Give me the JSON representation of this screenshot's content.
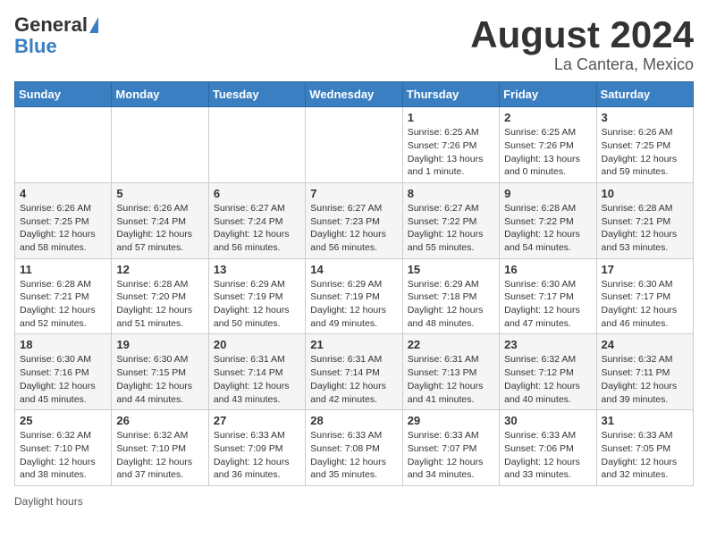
{
  "header": {
    "logo_general": "General",
    "logo_blue": "Blue",
    "title": "August 2024",
    "location": "La Cantera, Mexico"
  },
  "days_of_week": [
    "Sunday",
    "Monday",
    "Tuesday",
    "Wednesday",
    "Thursday",
    "Friday",
    "Saturday"
  ],
  "weeks": [
    [
      {
        "day": "",
        "sunrise": "",
        "sunset": "",
        "daylight": ""
      },
      {
        "day": "",
        "sunrise": "",
        "sunset": "",
        "daylight": ""
      },
      {
        "day": "",
        "sunrise": "",
        "sunset": "",
        "daylight": ""
      },
      {
        "day": "",
        "sunrise": "",
        "sunset": "",
        "daylight": ""
      },
      {
        "day": "1",
        "sunrise": "Sunrise: 6:25 AM",
        "sunset": "Sunset: 7:26 PM",
        "daylight": "Daylight: 13 hours and 1 minute."
      },
      {
        "day": "2",
        "sunrise": "Sunrise: 6:25 AM",
        "sunset": "Sunset: 7:26 PM",
        "daylight": "Daylight: 13 hours and 0 minutes."
      },
      {
        "day": "3",
        "sunrise": "Sunrise: 6:26 AM",
        "sunset": "Sunset: 7:25 PM",
        "daylight": "Daylight: 12 hours and 59 minutes."
      }
    ],
    [
      {
        "day": "4",
        "sunrise": "Sunrise: 6:26 AM",
        "sunset": "Sunset: 7:25 PM",
        "daylight": "Daylight: 12 hours and 58 minutes."
      },
      {
        "day": "5",
        "sunrise": "Sunrise: 6:26 AM",
        "sunset": "Sunset: 7:24 PM",
        "daylight": "Daylight: 12 hours and 57 minutes."
      },
      {
        "day": "6",
        "sunrise": "Sunrise: 6:27 AM",
        "sunset": "Sunset: 7:24 PM",
        "daylight": "Daylight: 12 hours and 56 minutes."
      },
      {
        "day": "7",
        "sunrise": "Sunrise: 6:27 AM",
        "sunset": "Sunset: 7:23 PM",
        "daylight": "Daylight: 12 hours and 56 minutes."
      },
      {
        "day": "8",
        "sunrise": "Sunrise: 6:27 AM",
        "sunset": "Sunset: 7:22 PM",
        "daylight": "Daylight: 12 hours and 55 minutes."
      },
      {
        "day": "9",
        "sunrise": "Sunrise: 6:28 AM",
        "sunset": "Sunset: 7:22 PM",
        "daylight": "Daylight: 12 hours and 54 minutes."
      },
      {
        "day": "10",
        "sunrise": "Sunrise: 6:28 AM",
        "sunset": "Sunset: 7:21 PM",
        "daylight": "Daylight: 12 hours and 53 minutes."
      }
    ],
    [
      {
        "day": "11",
        "sunrise": "Sunrise: 6:28 AM",
        "sunset": "Sunset: 7:21 PM",
        "daylight": "Daylight: 12 hours and 52 minutes."
      },
      {
        "day": "12",
        "sunrise": "Sunrise: 6:28 AM",
        "sunset": "Sunset: 7:20 PM",
        "daylight": "Daylight: 12 hours and 51 minutes."
      },
      {
        "day": "13",
        "sunrise": "Sunrise: 6:29 AM",
        "sunset": "Sunset: 7:19 PM",
        "daylight": "Daylight: 12 hours and 50 minutes."
      },
      {
        "day": "14",
        "sunrise": "Sunrise: 6:29 AM",
        "sunset": "Sunset: 7:19 PM",
        "daylight": "Daylight: 12 hours and 49 minutes."
      },
      {
        "day": "15",
        "sunrise": "Sunrise: 6:29 AM",
        "sunset": "Sunset: 7:18 PM",
        "daylight": "Daylight: 12 hours and 48 minutes."
      },
      {
        "day": "16",
        "sunrise": "Sunrise: 6:30 AM",
        "sunset": "Sunset: 7:17 PM",
        "daylight": "Daylight: 12 hours and 47 minutes."
      },
      {
        "day": "17",
        "sunrise": "Sunrise: 6:30 AM",
        "sunset": "Sunset: 7:17 PM",
        "daylight": "Daylight: 12 hours and 46 minutes."
      }
    ],
    [
      {
        "day": "18",
        "sunrise": "Sunrise: 6:30 AM",
        "sunset": "Sunset: 7:16 PM",
        "daylight": "Daylight: 12 hours and 45 minutes."
      },
      {
        "day": "19",
        "sunrise": "Sunrise: 6:30 AM",
        "sunset": "Sunset: 7:15 PM",
        "daylight": "Daylight: 12 hours and 44 minutes."
      },
      {
        "day": "20",
        "sunrise": "Sunrise: 6:31 AM",
        "sunset": "Sunset: 7:14 PM",
        "daylight": "Daylight: 12 hours and 43 minutes."
      },
      {
        "day": "21",
        "sunrise": "Sunrise: 6:31 AM",
        "sunset": "Sunset: 7:14 PM",
        "daylight": "Daylight: 12 hours and 42 minutes."
      },
      {
        "day": "22",
        "sunrise": "Sunrise: 6:31 AM",
        "sunset": "Sunset: 7:13 PM",
        "daylight": "Daylight: 12 hours and 41 minutes."
      },
      {
        "day": "23",
        "sunrise": "Sunrise: 6:32 AM",
        "sunset": "Sunset: 7:12 PM",
        "daylight": "Daylight: 12 hours and 40 minutes."
      },
      {
        "day": "24",
        "sunrise": "Sunrise: 6:32 AM",
        "sunset": "Sunset: 7:11 PM",
        "daylight": "Daylight: 12 hours and 39 minutes."
      }
    ],
    [
      {
        "day": "25",
        "sunrise": "Sunrise: 6:32 AM",
        "sunset": "Sunset: 7:10 PM",
        "daylight": "Daylight: 12 hours and 38 minutes."
      },
      {
        "day": "26",
        "sunrise": "Sunrise: 6:32 AM",
        "sunset": "Sunset: 7:10 PM",
        "daylight": "Daylight: 12 hours and 37 minutes."
      },
      {
        "day": "27",
        "sunrise": "Sunrise: 6:33 AM",
        "sunset": "Sunset: 7:09 PM",
        "daylight": "Daylight: 12 hours and 36 minutes."
      },
      {
        "day": "28",
        "sunrise": "Sunrise: 6:33 AM",
        "sunset": "Sunset: 7:08 PM",
        "daylight": "Daylight: 12 hours and 35 minutes."
      },
      {
        "day": "29",
        "sunrise": "Sunrise: 6:33 AM",
        "sunset": "Sunset: 7:07 PM",
        "daylight": "Daylight: 12 hours and 34 minutes."
      },
      {
        "day": "30",
        "sunrise": "Sunrise: 6:33 AM",
        "sunset": "Sunset: 7:06 PM",
        "daylight": "Daylight: 12 hours and 33 minutes."
      },
      {
        "day": "31",
        "sunrise": "Sunrise: 6:33 AM",
        "sunset": "Sunset: 7:05 PM",
        "daylight": "Daylight: 12 hours and 32 minutes."
      }
    ]
  ],
  "footer": {
    "daylight_label": "Daylight hours"
  }
}
